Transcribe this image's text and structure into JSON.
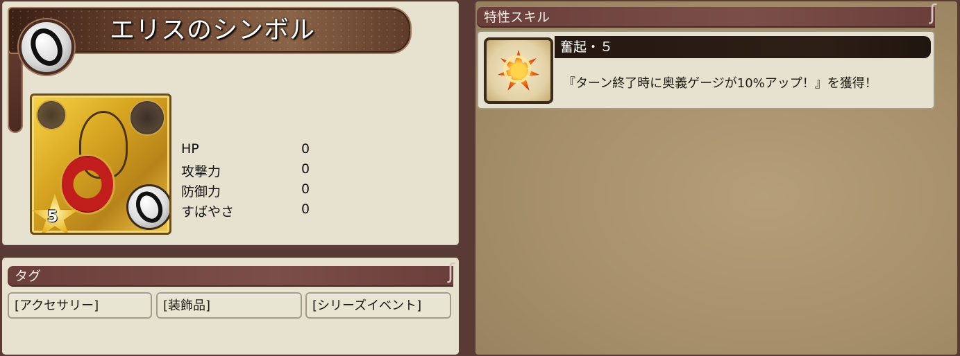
{
  "item": {
    "name": "エリスのシンボル",
    "type_icon": "ring-icon",
    "rarity_stars": "5",
    "stats": [
      {
        "label": "HP",
        "value": "0"
      },
      {
        "label": "攻撃力",
        "value": "0"
      },
      {
        "label": "防御力",
        "value": "0"
      },
      {
        "label": "すばやさ",
        "value": "0"
      }
    ]
  },
  "tags": {
    "header": "タグ",
    "items": [
      "[アクセサリー]",
      "[装飾品]",
      "[シリーズイベント]"
    ]
  },
  "skills": {
    "header": "特性スキル",
    "list": [
      {
        "name": "奮起・５",
        "description": "『ターン終了時に奥義ゲージが10%アップ！』を獲得！",
        "icon": "rally-burst-icon"
      }
    ]
  },
  "colors": {
    "panel": "#e6e2cf",
    "header": "#6a3e3a",
    "card_gold": "#d6a420",
    "skill_bg": "#a68f6a"
  }
}
